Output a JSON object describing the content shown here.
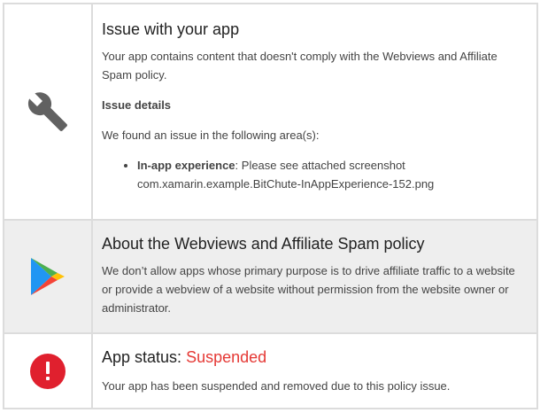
{
  "issue": {
    "title": "Issue with your app",
    "description": "Your app contains content that doesn't comply with the Webviews and Affiliate Spam policy.",
    "details_heading": "Issue details",
    "found_text": "We found an issue in the following area(s):",
    "area_label": "In-app experience",
    "area_text": ": Please see attached screenshot com.xamarin.example.BitChute-InAppExperience-152.png",
    "icon": "wrench-icon"
  },
  "policy": {
    "title": "About the Webviews and Affiliate Spam policy",
    "description": "We don’t allow apps whose primary purpose is to drive affiliate traffic to a website or provide a webview of a website without permission from the website owner or administrator.",
    "icon": "google-play-icon"
  },
  "status": {
    "title_prefix": "App status:",
    "value": "Suspended",
    "value_color": "#e53935",
    "description": "Your app has been suspended and removed due to this policy issue.",
    "icon": "error-icon"
  }
}
